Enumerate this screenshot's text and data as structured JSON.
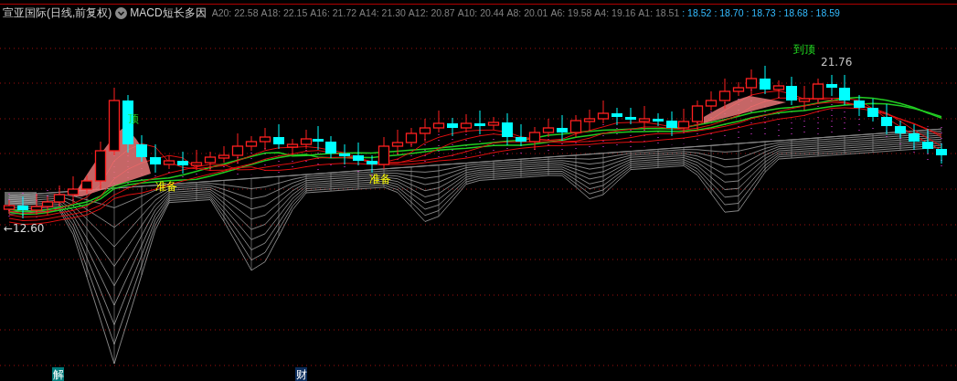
{
  "header": {
    "title": "宣亚国际(日线,前复权)",
    "indicator": "MACD短长多因",
    "values": [
      {
        "label": "A20: 22.58"
      },
      {
        "label": "A18: 22.15"
      },
      {
        "label": "A16: 21.72"
      },
      {
        "label": "A14: 21.30"
      },
      {
        "label": "A12: 20.87"
      },
      {
        "label": "A10: 20.44"
      },
      {
        "label": "A8: 20.01"
      },
      {
        "label": "A6: 19.58"
      },
      {
        "label": "A4: 19.16"
      },
      {
        "label": "A1: 18.51"
      }
    ],
    "readings": [
      ": 18.52",
      ": 18.70",
      ": 18.73",
      ": 18.68",
      ": 18.59"
    ]
  },
  "chart_labels": [
    {
      "text": "顶",
      "kind": "top"
    },
    {
      "text": "准备",
      "kind": "prepare"
    },
    {
      "text": "准备",
      "kind": "prepare"
    },
    {
      "text": "到顶",
      "kind": "top"
    },
    {
      "text": "21.76",
      "kind": "price"
    },
    {
      "text": "←12.60",
      "kind": "low"
    }
  ],
  "markers": [
    {
      "text": "解",
      "kind": "unlock"
    },
    {
      "text": "财",
      "kind": "finance"
    }
  ]
}
